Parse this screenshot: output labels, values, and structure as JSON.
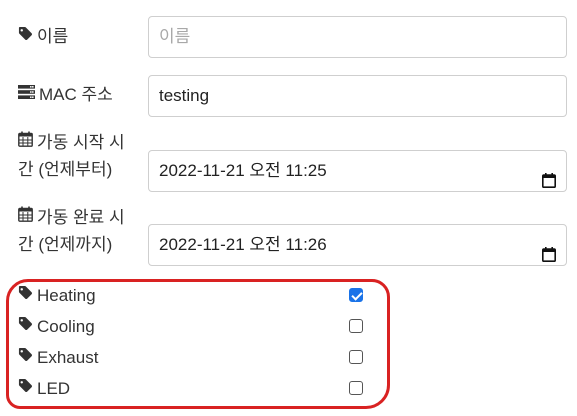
{
  "form": {
    "name": {
      "label": "이름",
      "placeholder": "이름",
      "value": ""
    },
    "mac": {
      "label": "MAC 주소",
      "value": "testing"
    },
    "start": {
      "label_line1": "가동 시작 시",
      "label_line2": "간 (언제부터)",
      "value": "2022-11-21 오전 11:25"
    },
    "end": {
      "label_line1": "가동 완료 시",
      "label_line2": "간 (언제까지)",
      "value": "2022-11-21 오전 11:26"
    }
  },
  "features": [
    {
      "label": "Heating",
      "checked": true
    },
    {
      "label": "Cooling",
      "checked": false
    },
    {
      "label": "Exhaust",
      "checked": false
    },
    {
      "label": "LED",
      "checked": false
    }
  ],
  "colors": {
    "highlight": "#d92222",
    "checkbox_checked": "#1a73e8"
  },
  "icons": {
    "name": "tag-icon",
    "mac": "server-icon",
    "start": "calendar-icon",
    "end": "calendar-icon",
    "feature": "tag-icon",
    "date_picker": "calendar-icon"
  }
}
